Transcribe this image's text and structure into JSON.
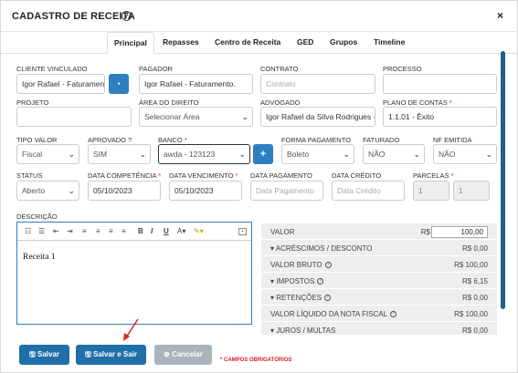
{
  "header": {
    "title": "CADASTRO DE RECEITA",
    "help_icon": "?",
    "close_icon": "×"
  },
  "tabs": [
    {
      "label": "Principal",
      "active": true
    },
    {
      "label": "Repasses"
    },
    {
      "label": "Centro de Receita"
    },
    {
      "label": "GED"
    },
    {
      "label": "Grupos"
    },
    {
      "label": "Timeline"
    }
  ],
  "fields": {
    "cliente": {
      "label": "CLIENTE VINCULADO",
      "value": "Igor Rafael - Faturament"
    },
    "pagador": {
      "label": "PAGADOR",
      "value": "Igor Rafael - Faturamento."
    },
    "contrato": {
      "label": "CONTRATO",
      "placeholder": "Contrato"
    },
    "processo": {
      "label": "PROCESSO",
      "value": ""
    },
    "projeto": {
      "label": "PROJETO",
      "value": ""
    },
    "area": {
      "label": "ÁREA DO DIREITO",
      "value": "Selecionar Área"
    },
    "advogado": {
      "label": "ADVOGADO",
      "value": "Igor Rafael da Silva Rodrigues -"
    },
    "plano": {
      "label": "PLANO DE CONTAS",
      "value": "1.1.01 - Êxito"
    },
    "tipo_valor": {
      "label": "TIPO VALOR",
      "value": "Fiscal"
    },
    "aprovado": {
      "label": "APROVADO ?",
      "value": "SIM"
    },
    "banco": {
      "label": "BANCO",
      "value": "awda - 123123"
    },
    "forma_pagamento": {
      "label": "FORMA PAGAMENTO",
      "value": "Boleto"
    },
    "faturado": {
      "label": "FATURADO",
      "value": "NÃO"
    },
    "nf_emitida": {
      "label": "NF EMITIDA",
      "value": "NÃO"
    },
    "status": {
      "label": "STATUS",
      "value": "Aberto"
    },
    "data_competencia": {
      "label": "DATA COMPETÊNCIA",
      "value": "05/10/2023"
    },
    "data_vencimento": {
      "label": "DATA VENCIMENTO",
      "value": "05/10/2023"
    },
    "data_pagamento": {
      "label": "DATA PAGAMENTO",
      "placeholder": "Data Pagamento"
    },
    "data_credito": {
      "label": "DATA CRÉDITO",
      "placeholder": "Data Crédito"
    },
    "parcelas": {
      "label": "PARCELAS",
      "value_a": "1",
      "value_b": "1"
    },
    "descricao": {
      "label": "DESCRIÇÃO",
      "value": "Receita 1"
    }
  },
  "required_mark": "*",
  "add_icon": "+",
  "editor_toolbar": [
    "list-ol",
    "list-ul",
    "indent-left",
    "indent-right",
    "align-left",
    "align-center",
    "align-right",
    "align-justify",
    "B",
    "I",
    "U",
    "A",
    "highlighter",
    "fullscreen"
  ],
  "summary": {
    "valor": {
      "label": "VALOR",
      "currency": "R$",
      "value": "100,00"
    },
    "acrescimos": {
      "label": "ACRÉSCIMOS / DESCONTO",
      "value": "R$ 0,00"
    },
    "valor_bruto": {
      "label": "VALOR BRUTO",
      "value": "R$ 100,00"
    },
    "impostos": {
      "label": "IMPOSTOS",
      "value": "R$ 6,15"
    },
    "retencoes": {
      "label": "RETENÇÕES",
      "value": "R$ 0,00"
    },
    "valor_liquido": {
      "label": "VALOR LÍQUIDO DA NOTA FISCAL",
      "value": "R$ 100,00"
    },
    "juros": {
      "label": "JUROS / MULTAS",
      "value": "R$ 0,00"
    }
  },
  "buttons": {
    "salvar": "Salvar",
    "salvar_sair": "Salvar e Sair",
    "cancelar": "Cancelar"
  },
  "required_note": "* CAMPOS OBRIGATÓRIOS",
  "colors": {
    "primary": "#1f6fa8",
    "required": "#e02020",
    "disabled": "#a9b4bd"
  }
}
